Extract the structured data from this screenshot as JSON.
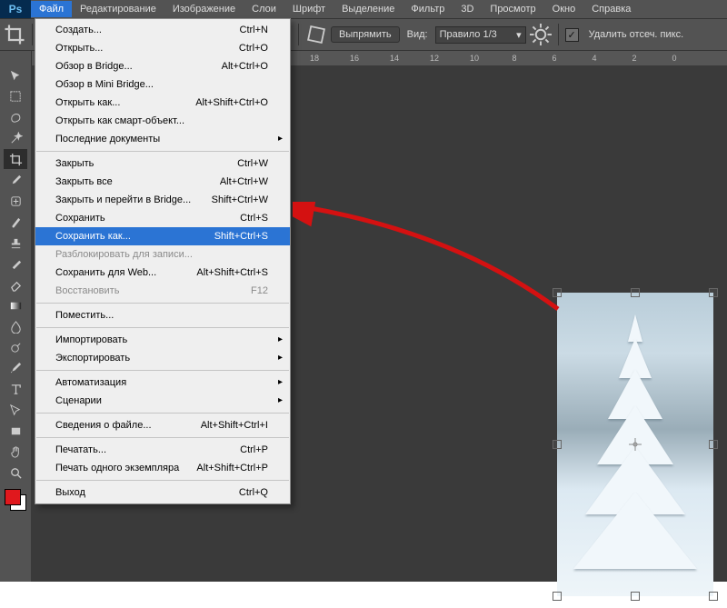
{
  "app": {
    "logo": "Ps"
  },
  "menubar": [
    "Файл",
    "Редактирование",
    "Изображение",
    "Слои",
    "Шрифт",
    "Выделение",
    "Фильтр",
    "3D",
    "Просмотр",
    "Окно",
    "Справка"
  ],
  "options": {
    "straighten": "Выпрямить",
    "view_label": "Вид:",
    "view_value": "Правило 1/3",
    "delete_crop": "Удалить отсеч. пикс."
  },
  "ruler": [
    "18",
    "16",
    "14",
    "12",
    "10",
    "8",
    "6",
    "4",
    "2",
    "0"
  ],
  "dropdown": [
    {
      "label": "Создать...",
      "shortcut": "Ctrl+N"
    },
    {
      "label": "Открыть...",
      "shortcut": "Ctrl+O"
    },
    {
      "label": "Обзор в Bridge...",
      "shortcut": "Alt+Ctrl+O"
    },
    {
      "label": "Обзор в Mini Bridge..."
    },
    {
      "label": "Открыть как...",
      "shortcut": "Alt+Shift+Ctrl+O"
    },
    {
      "label": "Открыть как смарт-объект..."
    },
    {
      "label": "Последние документы",
      "submenu": true
    },
    {
      "sep": true
    },
    {
      "label": "Закрыть",
      "shortcut": "Ctrl+W"
    },
    {
      "label": "Закрыть все",
      "shortcut": "Alt+Ctrl+W"
    },
    {
      "label": "Закрыть и перейти в Bridge...",
      "shortcut": "Shift+Ctrl+W"
    },
    {
      "label": "Сохранить",
      "shortcut": "Ctrl+S"
    },
    {
      "label": "Сохранить как...",
      "shortcut": "Shift+Ctrl+S",
      "highlight": true
    },
    {
      "label": "Разблокировать для записи...",
      "disabled": true
    },
    {
      "label": "Сохранить для Web...",
      "shortcut": "Alt+Shift+Ctrl+S"
    },
    {
      "label": "Восстановить",
      "shortcut": "F12",
      "disabled": true
    },
    {
      "sep": true
    },
    {
      "label": "Поместить..."
    },
    {
      "sep": true
    },
    {
      "label": "Импортировать",
      "submenu": true
    },
    {
      "label": "Экспортировать",
      "submenu": true
    },
    {
      "sep": true
    },
    {
      "label": "Автоматизация",
      "submenu": true
    },
    {
      "label": "Сценарии",
      "submenu": true
    },
    {
      "sep": true
    },
    {
      "label": "Сведения о файле...",
      "shortcut": "Alt+Shift+Ctrl+I"
    },
    {
      "sep": true
    },
    {
      "label": "Печатать...",
      "shortcut": "Ctrl+P"
    },
    {
      "label": "Печать одного экземпляра",
      "shortcut": "Alt+Shift+Ctrl+P"
    },
    {
      "sep": true
    },
    {
      "label": "Выход",
      "shortcut": "Ctrl+Q"
    }
  ],
  "tools": [
    "move",
    "marquee",
    "lasso",
    "wand",
    "crop",
    "eyedrop",
    "heal",
    "brush",
    "stamp",
    "history",
    "eraser",
    "gradient",
    "blur",
    "dodge",
    "pen",
    "type",
    "path",
    "rect",
    "hand",
    "zoom"
  ]
}
